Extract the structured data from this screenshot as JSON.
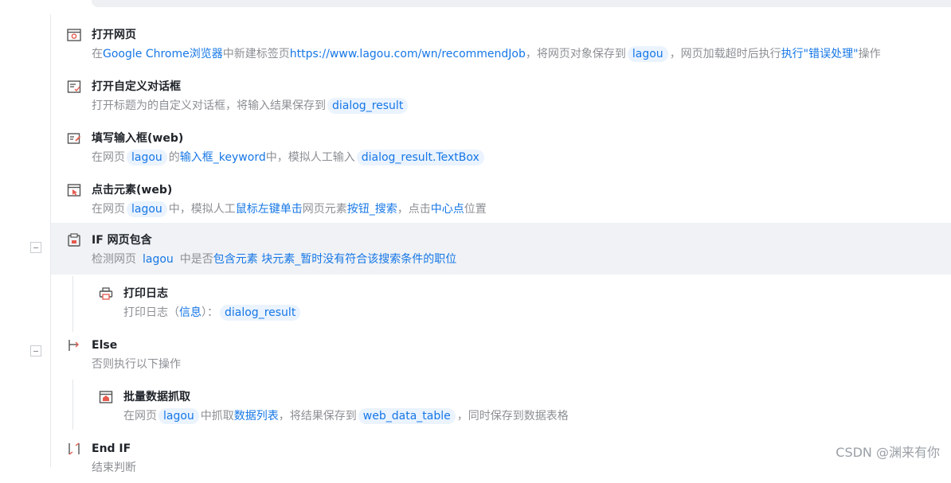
{
  "steps": [
    {
      "title": "打开网页",
      "desc": {
        "t1": "在",
        "browser": "Google Chrome浏览器",
        "t2": "中新建标签页",
        "url": "https://www.lagou.com/wn/recommendJob",
        "t3": "，将网页对象保存到",
        "var": "lagou",
        "t4": "，网页加载超时后执行",
        "action": "执行\"错误处理\"",
        "t5": "操作"
      }
    },
    {
      "title": "打开自定义对话框",
      "desc": {
        "t1": "打开标题为的自定义对话框，将输入结果保存到",
        "var": "dialog_result"
      }
    },
    {
      "title": "填写输入框(web)",
      "desc": {
        "t1": "在网页",
        "var1": "lagou",
        "t2": "的",
        "element": "输入框_keyword",
        "t3": "中，模拟人工输入",
        "var2": "dialog_result.TextBox"
      }
    },
    {
      "title": "点击元素(web)",
      "desc": {
        "t1": "在网页",
        "var1": "lagou",
        "t2": "中，模拟人工",
        "click": "鼠标左键单击",
        "t3": "网页元素",
        "element": "按钮_搜索",
        "t4": "，点击",
        "pos": "中心点",
        "t5": "位置"
      }
    },
    {
      "title": "IF 网页包含",
      "desc": {
        "t1": "检测网页",
        "var1": "lagou",
        "t2": "中是否",
        "cond": "包含元素 块元素_暂时没有符合该搜索条件的职位"
      }
    },
    {
      "title": "打印日志",
      "desc": {
        "t1": "打印日志（",
        "level": "信息",
        "t2": "）：",
        "var": "dialog_result"
      }
    },
    {
      "title": "Else",
      "desc": {
        "t1": "否则执行以下操作"
      }
    },
    {
      "title": "批量数据抓取",
      "desc": {
        "t1": "在网页",
        "var1": "lagou",
        "t2": "中抓取",
        "target": "数据列表",
        "t3": "，将结果保存到",
        "var2": "web_data_table",
        "t4": "，同时保存到数据表格"
      }
    },
    {
      "title": "End IF",
      "desc": {
        "t1": "结束判断"
      }
    }
  ],
  "watermark": "CSDN @渊来有你"
}
